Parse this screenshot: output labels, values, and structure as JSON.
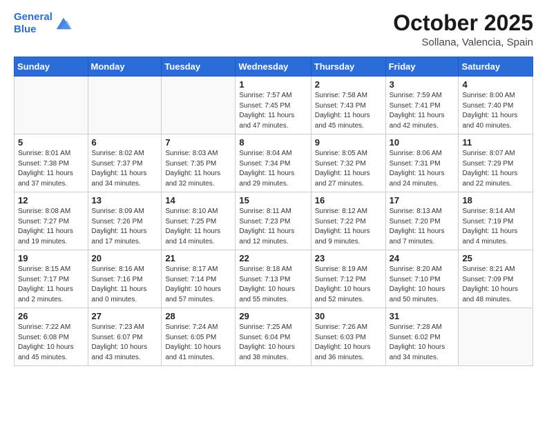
{
  "header": {
    "logo_line1": "General",
    "logo_line2": "Blue",
    "main_title": "October 2025",
    "subtitle": "Sollana, Valencia, Spain"
  },
  "days_of_week": [
    "Sunday",
    "Monday",
    "Tuesday",
    "Wednesday",
    "Thursday",
    "Friday",
    "Saturday"
  ],
  "weeks": [
    [
      {
        "day": "",
        "info": ""
      },
      {
        "day": "",
        "info": ""
      },
      {
        "day": "",
        "info": ""
      },
      {
        "day": "1",
        "info": "Sunrise: 7:57 AM\nSunset: 7:45 PM\nDaylight: 11 hours\nand 47 minutes."
      },
      {
        "day": "2",
        "info": "Sunrise: 7:58 AM\nSunset: 7:43 PM\nDaylight: 11 hours\nand 45 minutes."
      },
      {
        "day": "3",
        "info": "Sunrise: 7:59 AM\nSunset: 7:41 PM\nDaylight: 11 hours\nand 42 minutes."
      },
      {
        "day": "4",
        "info": "Sunrise: 8:00 AM\nSunset: 7:40 PM\nDaylight: 11 hours\nand 40 minutes."
      }
    ],
    [
      {
        "day": "5",
        "info": "Sunrise: 8:01 AM\nSunset: 7:38 PM\nDaylight: 11 hours\nand 37 minutes."
      },
      {
        "day": "6",
        "info": "Sunrise: 8:02 AM\nSunset: 7:37 PM\nDaylight: 11 hours\nand 34 minutes."
      },
      {
        "day": "7",
        "info": "Sunrise: 8:03 AM\nSunset: 7:35 PM\nDaylight: 11 hours\nand 32 minutes."
      },
      {
        "day": "8",
        "info": "Sunrise: 8:04 AM\nSunset: 7:34 PM\nDaylight: 11 hours\nand 29 minutes."
      },
      {
        "day": "9",
        "info": "Sunrise: 8:05 AM\nSunset: 7:32 PM\nDaylight: 11 hours\nand 27 minutes."
      },
      {
        "day": "10",
        "info": "Sunrise: 8:06 AM\nSunset: 7:31 PM\nDaylight: 11 hours\nand 24 minutes."
      },
      {
        "day": "11",
        "info": "Sunrise: 8:07 AM\nSunset: 7:29 PM\nDaylight: 11 hours\nand 22 minutes."
      }
    ],
    [
      {
        "day": "12",
        "info": "Sunrise: 8:08 AM\nSunset: 7:27 PM\nDaylight: 11 hours\nand 19 minutes."
      },
      {
        "day": "13",
        "info": "Sunrise: 8:09 AM\nSunset: 7:26 PM\nDaylight: 11 hours\nand 17 minutes."
      },
      {
        "day": "14",
        "info": "Sunrise: 8:10 AM\nSunset: 7:25 PM\nDaylight: 11 hours\nand 14 minutes."
      },
      {
        "day": "15",
        "info": "Sunrise: 8:11 AM\nSunset: 7:23 PM\nDaylight: 11 hours\nand 12 minutes."
      },
      {
        "day": "16",
        "info": "Sunrise: 8:12 AM\nSunset: 7:22 PM\nDaylight: 11 hours\nand 9 minutes."
      },
      {
        "day": "17",
        "info": "Sunrise: 8:13 AM\nSunset: 7:20 PM\nDaylight: 11 hours\nand 7 minutes."
      },
      {
        "day": "18",
        "info": "Sunrise: 8:14 AM\nSunset: 7:19 PM\nDaylight: 11 hours\nand 4 minutes."
      }
    ],
    [
      {
        "day": "19",
        "info": "Sunrise: 8:15 AM\nSunset: 7:17 PM\nDaylight: 11 hours\nand 2 minutes."
      },
      {
        "day": "20",
        "info": "Sunrise: 8:16 AM\nSunset: 7:16 PM\nDaylight: 11 hours\nand 0 minutes."
      },
      {
        "day": "21",
        "info": "Sunrise: 8:17 AM\nSunset: 7:14 PM\nDaylight: 10 hours\nand 57 minutes."
      },
      {
        "day": "22",
        "info": "Sunrise: 8:18 AM\nSunset: 7:13 PM\nDaylight: 10 hours\nand 55 minutes."
      },
      {
        "day": "23",
        "info": "Sunrise: 8:19 AM\nSunset: 7:12 PM\nDaylight: 10 hours\nand 52 minutes."
      },
      {
        "day": "24",
        "info": "Sunrise: 8:20 AM\nSunset: 7:10 PM\nDaylight: 10 hours\nand 50 minutes."
      },
      {
        "day": "25",
        "info": "Sunrise: 8:21 AM\nSunset: 7:09 PM\nDaylight: 10 hours\nand 48 minutes."
      }
    ],
    [
      {
        "day": "26",
        "info": "Sunrise: 7:22 AM\nSunset: 6:08 PM\nDaylight: 10 hours\nand 45 minutes."
      },
      {
        "day": "27",
        "info": "Sunrise: 7:23 AM\nSunset: 6:07 PM\nDaylight: 10 hours\nand 43 minutes."
      },
      {
        "day": "28",
        "info": "Sunrise: 7:24 AM\nSunset: 6:05 PM\nDaylight: 10 hours\nand 41 minutes."
      },
      {
        "day": "29",
        "info": "Sunrise: 7:25 AM\nSunset: 6:04 PM\nDaylight: 10 hours\nand 38 minutes."
      },
      {
        "day": "30",
        "info": "Sunrise: 7:26 AM\nSunset: 6:03 PM\nDaylight: 10 hours\nand 36 minutes."
      },
      {
        "day": "31",
        "info": "Sunrise: 7:28 AM\nSunset: 6:02 PM\nDaylight: 10 hours\nand 34 minutes."
      },
      {
        "day": "",
        "info": ""
      }
    ]
  ]
}
